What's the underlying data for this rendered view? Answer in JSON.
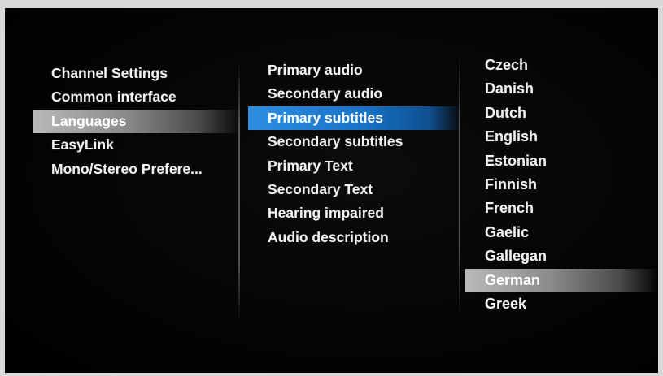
{
  "settings_menu": {
    "items": [
      {
        "label": "Channel Settings"
      },
      {
        "label": "Common interface"
      },
      {
        "label": "Languages"
      },
      {
        "label": "EasyLink"
      },
      {
        "label": "Mono/Stereo Prefere..."
      }
    ],
    "selected_index": 2
  },
  "languages_menu": {
    "items": [
      {
        "label": "Primary audio"
      },
      {
        "label": "Secondary audio"
      },
      {
        "label": "Primary subtitles"
      },
      {
        "label": "Secondary subtitles"
      },
      {
        "label": "Primary Text"
      },
      {
        "label": "Secondary Text"
      },
      {
        "label": "Hearing impaired"
      },
      {
        "label": "Audio description"
      }
    ],
    "selected_index": 2
  },
  "language_options": {
    "items": [
      {
        "label": "Czech"
      },
      {
        "label": "Danish"
      },
      {
        "label": "Dutch"
      },
      {
        "label": "English"
      },
      {
        "label": "Estonian"
      },
      {
        "label": "Finnish"
      },
      {
        "label": "French"
      },
      {
        "label": "Gaelic"
      },
      {
        "label": "Gallegan"
      },
      {
        "label": "German"
      },
      {
        "label": "Greek"
      }
    ],
    "selected_index": 9
  },
  "colors": {
    "focus_highlight": "#1e7fd6",
    "path_highlight": "#9a9a9a",
    "text": "#f1f1f1",
    "background": "#050505"
  }
}
